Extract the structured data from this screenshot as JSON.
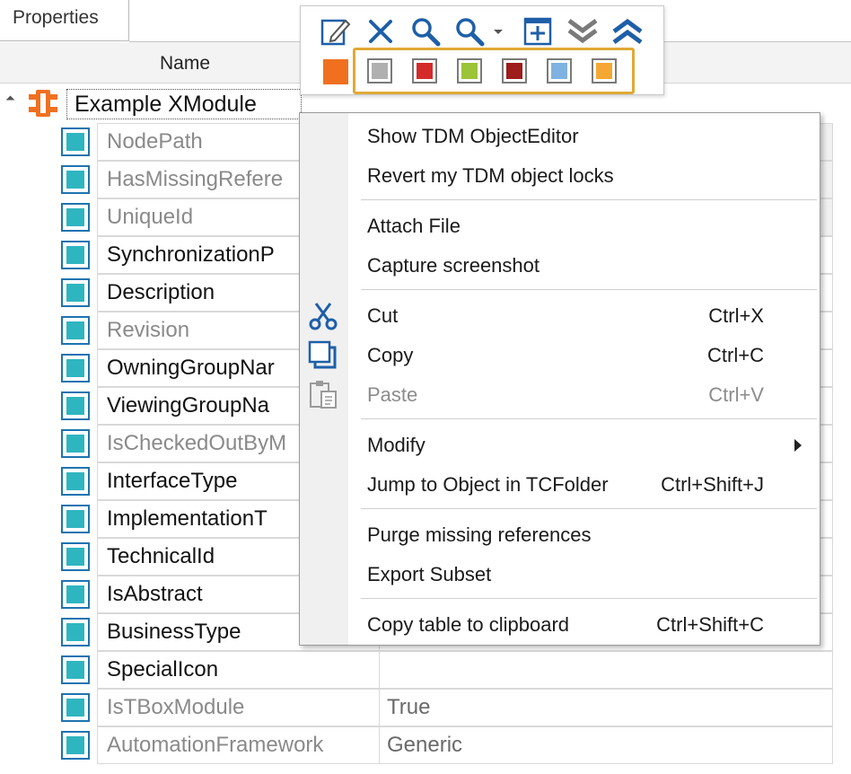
{
  "tab": {
    "label": "Properties"
  },
  "header": {
    "name_col": "Name"
  },
  "root": {
    "label": "Example XModule"
  },
  "rows": [
    {
      "name": "NodePath",
      "value": "",
      "readonly": true
    },
    {
      "name": "HasMissingRefere",
      "value": "",
      "readonly": true
    },
    {
      "name": "UniqueId",
      "value": "",
      "readonly": true
    },
    {
      "name": "SynchronizationP",
      "value": "",
      "readonly": false
    },
    {
      "name": "Description",
      "value": "",
      "readonly": false
    },
    {
      "name": "Revision",
      "value": "",
      "readonly": true
    },
    {
      "name": "OwningGroupNar",
      "value": "",
      "readonly": false
    },
    {
      "name": "ViewingGroupNa",
      "value": "",
      "readonly": false
    },
    {
      "name": "IsCheckedOutByM",
      "value": "",
      "readonly": true
    },
    {
      "name": "InterfaceType",
      "value": "",
      "readonly": false
    },
    {
      "name": "ImplementationT",
      "value": "",
      "readonly": false
    },
    {
      "name": "TechnicalId",
      "value": "",
      "readonly": false
    },
    {
      "name": "IsAbstract",
      "value": "",
      "readonly": false
    },
    {
      "name": "BusinessType",
      "value": "",
      "readonly": false
    },
    {
      "name": "SpecialIcon",
      "value": "",
      "readonly": false
    },
    {
      "name": "IsTBoxModule",
      "value": "True",
      "readonly": true
    },
    {
      "name": "AutomationFramework",
      "value": "Generic",
      "readonly": true
    }
  ],
  "toolbar": {
    "icons": [
      "edit-icon",
      "delete-icon",
      "search-icon",
      "search-dropdown-icon",
      "add-window-icon",
      "collapse-down-icon",
      "expand-up-icon"
    ],
    "primary_color": "#f07020",
    "swatches": [
      "#b0b0b0",
      "#d42a2a",
      "#9bc437",
      "#9e1c1c",
      "#7fb2e0",
      "#f4a833"
    ]
  },
  "menu": {
    "items": [
      {
        "label": "Show TDM ObjectEditor",
        "shortcut": ""
      },
      {
        "label": "Revert my TDM object locks",
        "shortcut": ""
      },
      {
        "label": "Attach File",
        "shortcut": ""
      },
      {
        "label": "Capture screenshot",
        "shortcut": ""
      },
      {
        "label": "Cut",
        "shortcut": "Ctrl+X",
        "icon": "scissors-icon"
      },
      {
        "label": "Copy",
        "shortcut": "Ctrl+C",
        "icon": "copy-icon"
      },
      {
        "label": "Paste",
        "shortcut": "Ctrl+V",
        "icon": "paste-icon",
        "disabled": true
      },
      {
        "label": "Modify",
        "shortcut": "",
        "submenu": true
      },
      {
        "label": "Jump to Object in TCFolder",
        "shortcut": "Ctrl+Shift+J"
      },
      {
        "label": "Purge missing references",
        "shortcut": ""
      },
      {
        "label": "Export Subset",
        "shortcut": ""
      },
      {
        "label": "Copy table to clipboard",
        "shortcut": "Ctrl+Shift+C"
      }
    ]
  }
}
